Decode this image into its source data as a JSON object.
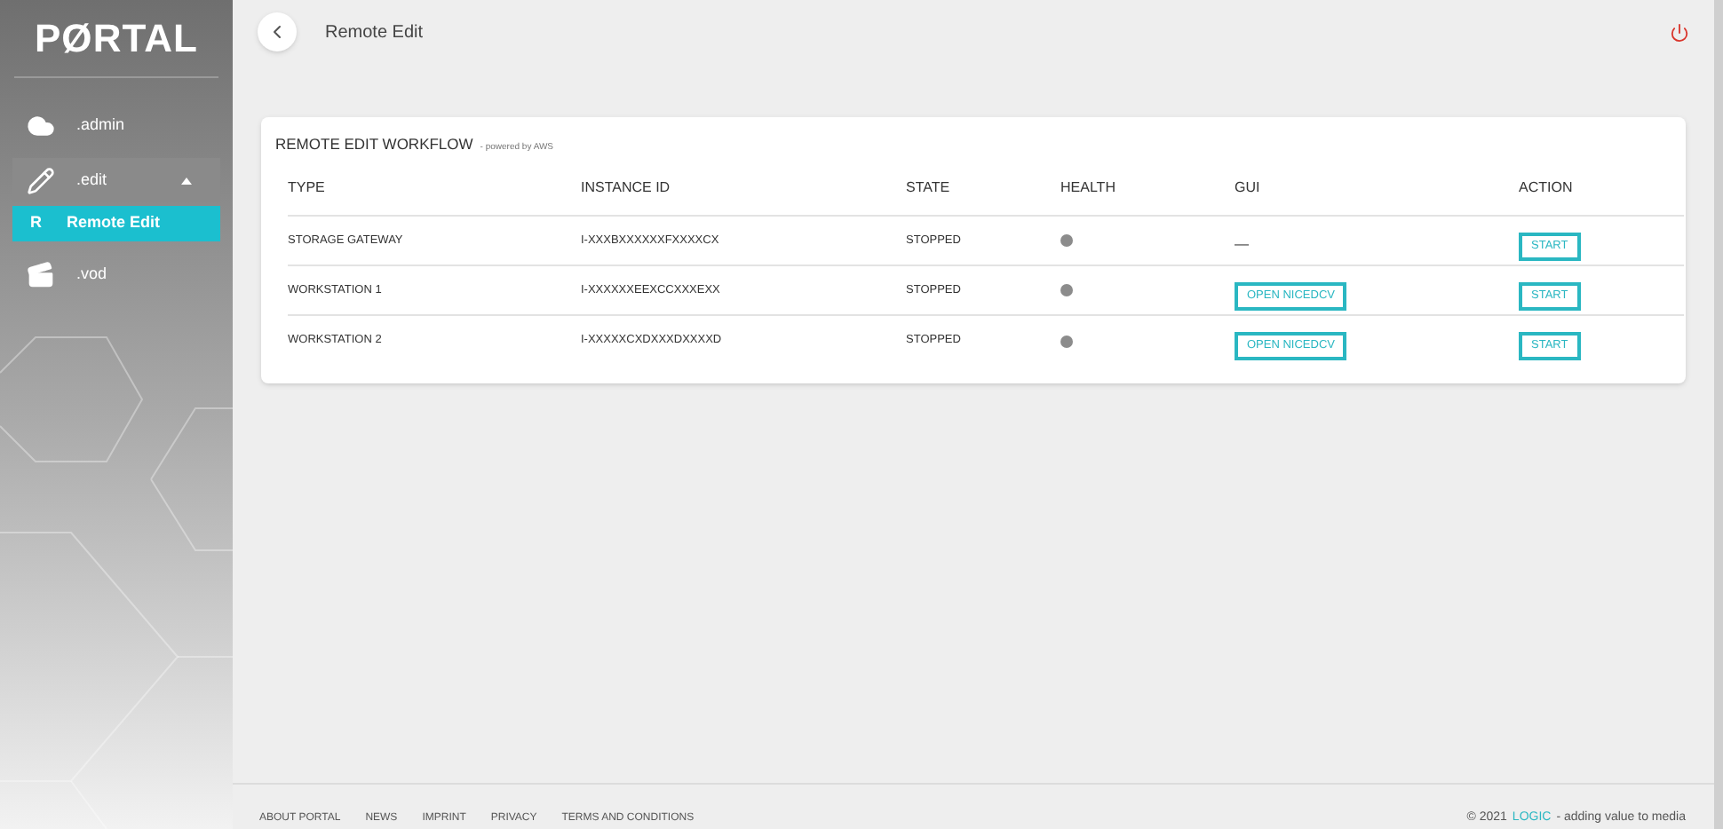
{
  "sidebar": {
    "logo": "PØRTAL",
    "items": [
      {
        "kind": "cloud",
        "label": ".admin",
        "expanded": false,
        "selected": false
      },
      {
        "kind": "pencil",
        "label": ".edit",
        "expanded": true,
        "selected": false,
        "children": [
          {
            "letter": "R",
            "label": "Remote Edit",
            "selected": true
          }
        ]
      },
      {
        "kind": "clapper",
        "label": ".vod",
        "expanded": false,
        "selected": false
      }
    ]
  },
  "header": {
    "title": "Remote Edit"
  },
  "card": {
    "title": "REMOTE EDIT WORKFLOW",
    "subtitle": "- powered by AWS",
    "columns": [
      "TYPE",
      "INSTANCE ID",
      "STATE",
      "HEALTH",
      "GUI",
      "ACTION"
    ],
    "rows": [
      {
        "type": "STORAGE GATEWAY",
        "instance_id": "I-XXXBXXXXXXFXXXXCX",
        "state": "STOPPED",
        "color": "#8c8c8c",
        "gui": {
          "kind": "text",
          "label": "—"
        },
        "action": "START"
      },
      {
        "type": "WORKSTATION 1",
        "instance_id": "I-XXXXXXEEXCCXXXEXX",
        "state": "STOPPED",
        "color": "#8c8c8c",
        "gui": {
          "kind": "button",
          "label": "OPEN NICEDCV"
        },
        "action": "START"
      },
      {
        "type": "WORKSTATION 2",
        "instance_id": "I-XXXXXCXDXXXDXXXXD",
        "state": "STOPPED",
        "color": "#8c8c8c",
        "gui": {
          "kind": "button",
          "label": "OPEN NICEDCV"
        },
        "action": "START"
      }
    ]
  },
  "footer": {
    "links": [
      "ABOUT PORTAL",
      "NEWS",
      "IMPRINT",
      "PRIVACY",
      "TERMS AND CONDITIONS"
    ],
    "copyright": "© 2021",
    "brand": "LOGIC",
    "tagline": "- adding value to media"
  }
}
